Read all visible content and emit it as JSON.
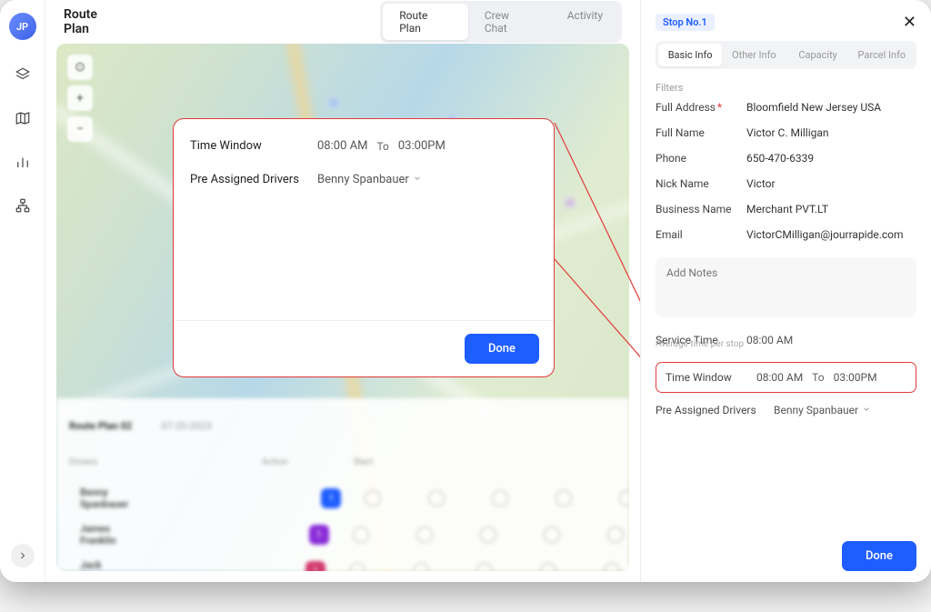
{
  "user_initials": "JP",
  "page_title": "Route Plan",
  "top_tabs": [
    "Route Plan",
    "Crew Chat",
    "Activity"
  ],
  "active_top_tab": 0,
  "popup": {
    "time_window_label": "Time Window",
    "time_start": "08:00 AM",
    "to": "To",
    "time_end": "03:00PM",
    "pre_assigned_label": "Pre Assigned Drivers",
    "driver": "Benny Spanbauer",
    "done": "Done"
  },
  "side": {
    "stop_chip": "Stop No.1",
    "tabs": [
      "Basic Info",
      "Other Info",
      "Capacity",
      "Parcel Info"
    ],
    "active_tab": 0,
    "filters_label": "Filters",
    "fields": {
      "address_label": "Full Address",
      "address": "Bloomfield New Jersey USA",
      "name_label": "Full Name",
      "name": "Victor C. Milligan",
      "phone_label": "Phone",
      "phone": "650-470-6339",
      "nick_label": "Nick Name",
      "nick": "Victor",
      "biz_label": "Business Name",
      "biz": "Merchant PVT.LT",
      "email_label": "Email",
      "email": "VictorCMilligan@jourrapide.com"
    },
    "notes_placeholder": "Add Notes",
    "service_time_label": "Service Time",
    "service_time_sub": "Average time per stop",
    "service_time": "08:00 AM",
    "time_window_label": "Time Window",
    "time_start": "08:00 AM",
    "to": "To",
    "time_end": "03:00PM",
    "pre_assigned_label": "Pre Assigned Drivers",
    "driver": "Benny Spanbauer",
    "done": "Done"
  }
}
